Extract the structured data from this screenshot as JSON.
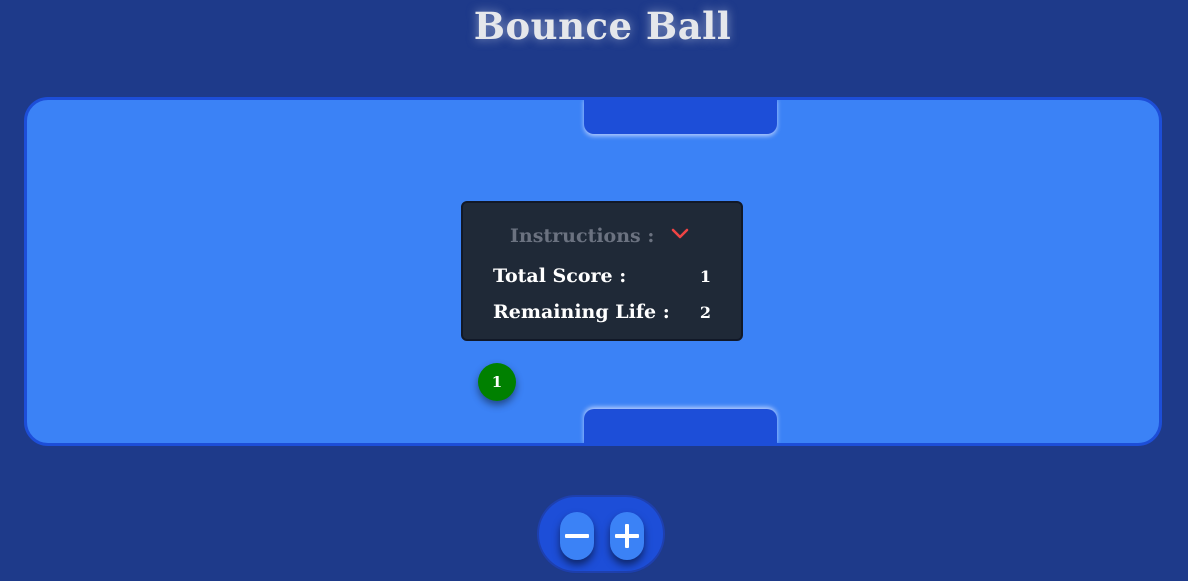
{
  "header": {
    "title": "Bounce Ball"
  },
  "panel": {
    "instructions_label": "Instructions :",
    "toggle_icon": "chevron-down-icon",
    "score_label": "Total Score :",
    "score_value": "1",
    "life_label": "Remaining Life :",
    "life_value": "2"
  },
  "ball": {
    "label": "1",
    "color": "#008000"
  },
  "controls": {
    "decrease_icon": "minus-icon",
    "increase_icon": "plus-icon"
  },
  "colors": {
    "background": "#1e3a8a",
    "board": "#3b82f6",
    "paddle": "#1d4ed8",
    "panel": "#1f2937",
    "chevron": "#ef4444"
  }
}
